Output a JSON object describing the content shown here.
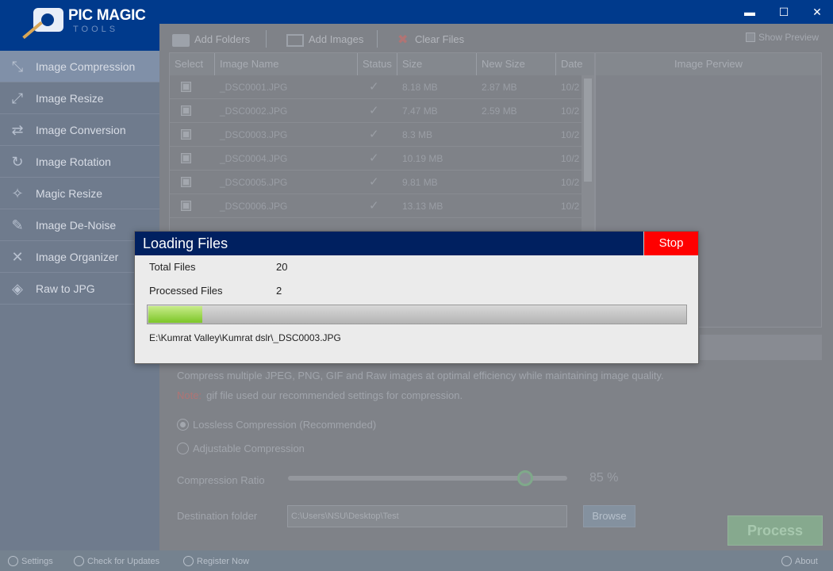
{
  "app": {
    "title": "PIC MAGIC",
    "subtitle": "TOOLS"
  },
  "window_controls": {
    "minimize": "▬",
    "maximize": "☐",
    "close": "✕"
  },
  "sidebar": {
    "items": [
      {
        "label": "Image Compression",
        "icon": "compress-icon",
        "glyph": "⤡",
        "active": true
      },
      {
        "label": "Image Resize",
        "icon": "resize-icon",
        "glyph": "⤢",
        "active": false
      },
      {
        "label": "Image Conversion",
        "icon": "convert-icon",
        "glyph": "⇄",
        "active": false
      },
      {
        "label": "Image Rotation",
        "icon": "rotate-icon",
        "glyph": "↻",
        "active": false
      },
      {
        "label": "Magic Resize",
        "icon": "magic-wand-icon",
        "glyph": "✧",
        "active": false
      },
      {
        "label": "Image De-Noise",
        "icon": "brush-icon",
        "glyph": "✎",
        "active": false
      },
      {
        "label": "Image Organizer",
        "icon": "tools-icon",
        "glyph": "✕",
        "active": false
      },
      {
        "label": "Raw to JPG",
        "icon": "raw-icon",
        "glyph": "◈",
        "active": false
      }
    ]
  },
  "toolbar": {
    "add_folders": "Add Folders",
    "add_images": "Add Images",
    "clear_files": "Clear Files",
    "show_preview": "Show Preview"
  },
  "table": {
    "columns": [
      "Select",
      "Image Name",
      "Status",
      "Size",
      "New Size",
      "Date"
    ],
    "rows": [
      {
        "name": "_DSC0001.JPG",
        "status": "✓",
        "size": "8.18 MB",
        "new_size": "2.87 MB",
        "date": "10/2"
      },
      {
        "name": "_DSC0002.JPG",
        "status": "✓",
        "size": "7.47 MB",
        "new_size": "2.59 MB",
        "date": "10/2"
      },
      {
        "name": "_DSC0003.JPG",
        "status": "✓",
        "size": "8.3 MB",
        "new_size": "",
        "date": "10/2"
      },
      {
        "name": "_DSC0004.JPG",
        "status": "✓",
        "size": "10.19 MB",
        "new_size": "",
        "date": "10/2"
      },
      {
        "name": "_DSC0005.JPG",
        "status": "✓",
        "size": "9.81 MB",
        "new_size": "",
        "date": "10/2"
      },
      {
        "name": "_DSC0006.JPG",
        "status": "✓",
        "size": "13.13 MB",
        "new_size": "",
        "date": "10/2"
      }
    ]
  },
  "preview": {
    "header": "Image Perview"
  },
  "description": "Compress multiple JPEG, PNG, GIF and Raw images at optimal efficiency while maintaining image quality.",
  "note": {
    "label": "Note:",
    "text": "gif file used our recommended settings for compression."
  },
  "options": {
    "lossless": "Lossless Compression (Recommended)",
    "adjustable": "Adjustable Compression",
    "selected": "lossless"
  },
  "compression": {
    "label": "Compression Ratio",
    "value": "85 %",
    "fraction": 0.85
  },
  "destination": {
    "label": "Destination folder",
    "path": "C:\\Users\\NSU\\Desktop\\Test",
    "browse": "Browse"
  },
  "process_button": "Process",
  "statusbar": {
    "settings": "Settings",
    "check_updates": "Check for Updates",
    "register": "Register Now",
    "about": "About"
  },
  "dialog": {
    "title": "Loading Files",
    "stop": "Stop",
    "total_label": "Total Files",
    "total_value": "20",
    "processed_label": "Processed Files",
    "processed_value": "2",
    "progress": 0.1,
    "current_path": "E:\\Kumrat Valley\\Kumrat dslr\\_DSC0003.JPG"
  },
  "colors": {
    "title_blue": "#003a8c",
    "dialog_header": "#002060",
    "stop_red": "#ff0000",
    "progress_green": "#7cc628"
  }
}
